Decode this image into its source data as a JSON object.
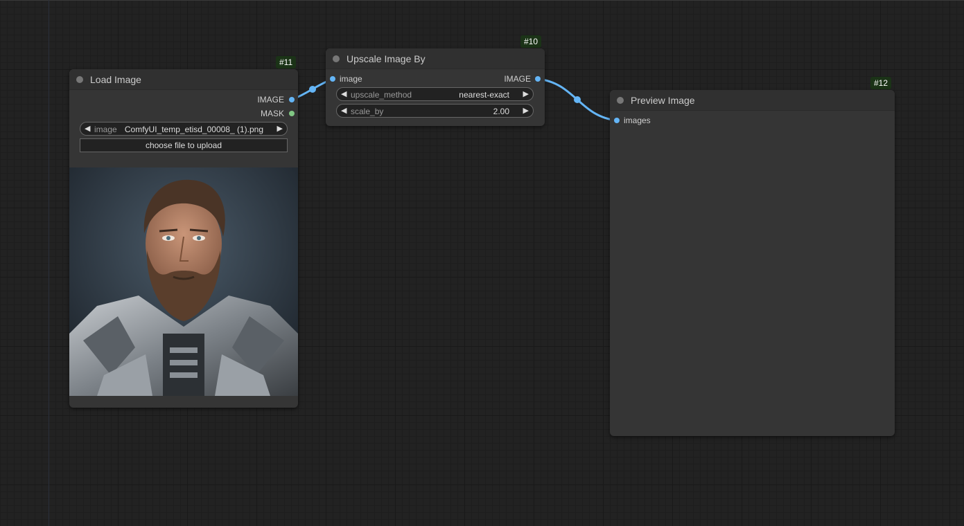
{
  "colors": {
    "canvas_bg": "#222222",
    "node_bg": "#353535",
    "node_title_bg": "#303030",
    "image_link": "#64b5f6",
    "mask_slot": "#81c784",
    "id_badge_bg": "#1b3317"
  },
  "nodes": {
    "load_image": {
      "id": "#11",
      "title": "Load Image",
      "outputs": [
        {
          "label": "IMAGE",
          "color": "#64b5f6"
        },
        {
          "label": "MASK",
          "color": "#81c784"
        }
      ],
      "widget": {
        "name": "image",
        "value": "ComfyUI_temp_etisd_00008_ (1).png"
      },
      "upload_label": "choose file to upload",
      "preview_icon": "portrait-preview-image"
    },
    "upscale_image_by": {
      "id": "#10",
      "title": "Upscale Image By",
      "input_label": "image",
      "output_label": "IMAGE",
      "widgets": [
        {
          "name": "upscale_method",
          "value": "nearest-exact"
        },
        {
          "name": "scale_by",
          "value": "2.00"
        }
      ]
    },
    "preview_image": {
      "id": "#12",
      "title": "Preview Image",
      "input_label": "images"
    }
  }
}
